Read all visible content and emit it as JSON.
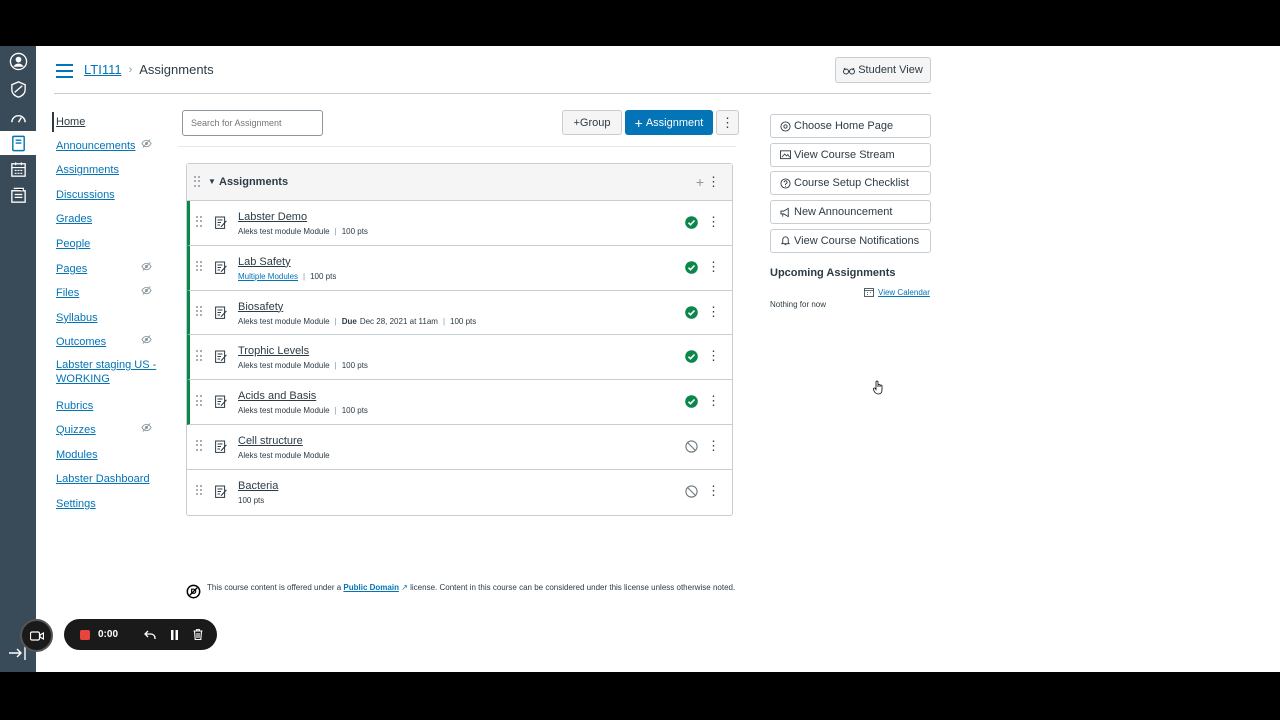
{
  "header": {
    "course_link": "LTI111",
    "crumb_current": "Assignments",
    "student_view": "Student View"
  },
  "course_nav": [
    {
      "label": "Home",
      "hidden": false
    },
    {
      "label": "Announcements",
      "hidden": true
    },
    {
      "label": "Assignments",
      "hidden": false
    },
    {
      "label": "Discussions",
      "hidden": false
    },
    {
      "label": "Grades",
      "hidden": false
    },
    {
      "label": "People",
      "hidden": false
    },
    {
      "label": "Pages",
      "hidden": true
    },
    {
      "label": "Files",
      "hidden": true
    },
    {
      "label": "Syllabus",
      "hidden": false
    },
    {
      "label": "Outcomes",
      "hidden": true
    },
    {
      "label": "Labster staging US - WORKING",
      "hidden": false
    },
    {
      "label": "Rubrics",
      "hidden": false
    },
    {
      "label": "Quizzes",
      "hidden": true
    },
    {
      "label": "Modules",
      "hidden": false
    },
    {
      "label": "Labster Dashboard",
      "hidden": false
    },
    {
      "label": "Settings",
      "hidden": false
    }
  ],
  "toolbar": {
    "search_placeholder": "Search for Assignment",
    "group_label": "Group",
    "assignment_label": "Assignment"
  },
  "group": {
    "title": "Assignments",
    "items": [
      {
        "name": "Labster Demo",
        "module": "Aleks test module Module",
        "module_link": false,
        "due": "",
        "points": "100 pts",
        "published": true
      },
      {
        "name": "Lab Safety",
        "module": "Multiple Modules",
        "module_link": true,
        "due": "",
        "points": "100 pts",
        "published": true
      },
      {
        "name": "Biosafety",
        "module": "Aleks test module Module",
        "module_link": false,
        "due_label": "Due",
        "due": "Dec 28, 2021 at 11am",
        "points": "100 pts",
        "published": true
      },
      {
        "name": "Trophic Levels",
        "module": "Aleks test module Module",
        "module_link": false,
        "due": "",
        "points": "100 pts",
        "published": true
      },
      {
        "name": "Acids and Basis",
        "module": "Aleks test module Module",
        "module_link": false,
        "due": "",
        "points": "100 pts",
        "published": true
      },
      {
        "name": "Cell structure",
        "module": "Aleks test module Module",
        "module_link": false,
        "due": "",
        "points": "",
        "published": false
      },
      {
        "name": "Bacteria",
        "module": "",
        "module_link": false,
        "due": "",
        "points": "100 pts",
        "published": false
      }
    ]
  },
  "license": {
    "prefix": "This course content is offered under a",
    "link": "Public Domain",
    "suffix": "license. Content in this course can be considered under this license unless otherwise noted."
  },
  "sidebar": {
    "buttons": [
      "Choose Home Page",
      "View Course Stream",
      "Course Setup Checklist",
      "New Announcement",
      "View Course Notifications"
    ],
    "upcoming_title": "Upcoming Assignments",
    "view_calendar": "View Calendar",
    "nothing": "Nothing for now"
  },
  "recorder": {
    "time": "0:00"
  },
  "colors": {
    "brand": "#0374b5",
    "published": "#0b874b",
    "nav_bg": "#394b58"
  }
}
